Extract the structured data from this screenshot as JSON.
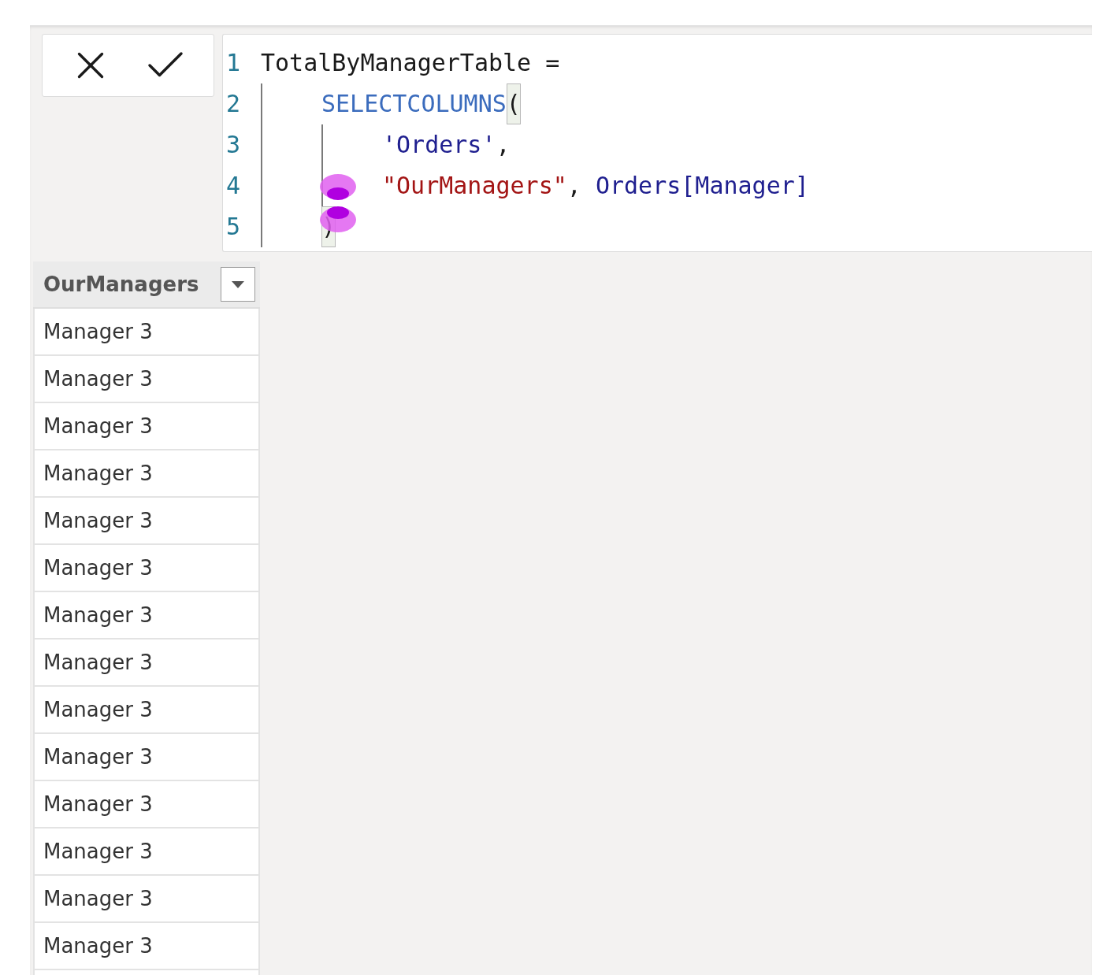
{
  "formula_bar": {
    "lines": [
      {
        "number": "1",
        "tokens": [
          {
            "kind": "plain",
            "text": "TotalByManagerTable ="
          }
        ],
        "children": [
          {
            "number": "2",
            "tokens": [
              {
                "kind": "function",
                "text": "SELECTCOLUMNS"
              },
              {
                "kind": "bracket",
                "text": "(",
                "matched": true
              }
            ],
            "children": [
              {
                "number": "3",
                "tokens": [
                  {
                    "kind": "table",
                    "text": "'Orders'"
                  },
                  {
                    "kind": "plain",
                    "text": ","
                  }
                ]
              },
              {
                "number": "4",
                "tokens": [
                  {
                    "kind": "string",
                    "text": "\"OurManagers\""
                  },
                  {
                    "kind": "plain",
                    "text": ", "
                  },
                  {
                    "kind": "table",
                    "text": "Orders[Manager]"
                  }
                ]
              }
            ]
          },
          {
            "number": "5",
            "tokens": [
              {
                "kind": "bracket",
                "text": ")",
                "matched": true
              }
            ]
          }
        ]
      }
    ]
  },
  "table": {
    "columns": [
      {
        "name": "OurManagers"
      }
    ],
    "rows": [
      {
        "cells": [
          "Manager 3"
        ]
      },
      {
        "cells": [
          "Manager 3"
        ]
      },
      {
        "cells": [
          "Manager 3"
        ]
      },
      {
        "cells": [
          "Manager 3"
        ]
      },
      {
        "cells": [
          "Manager 3"
        ]
      },
      {
        "cells": [
          "Manager 3"
        ]
      },
      {
        "cells": [
          "Manager 3"
        ]
      },
      {
        "cells": [
          "Manager 3"
        ]
      },
      {
        "cells": [
          "Manager 3"
        ]
      },
      {
        "cells": [
          "Manager 3"
        ]
      },
      {
        "cells": [
          "Manager 3"
        ]
      },
      {
        "cells": [
          "Manager 3"
        ]
      },
      {
        "cells": [
          "Manager 3"
        ]
      },
      {
        "cells": [
          "Manager 3"
        ]
      }
    ]
  }
}
